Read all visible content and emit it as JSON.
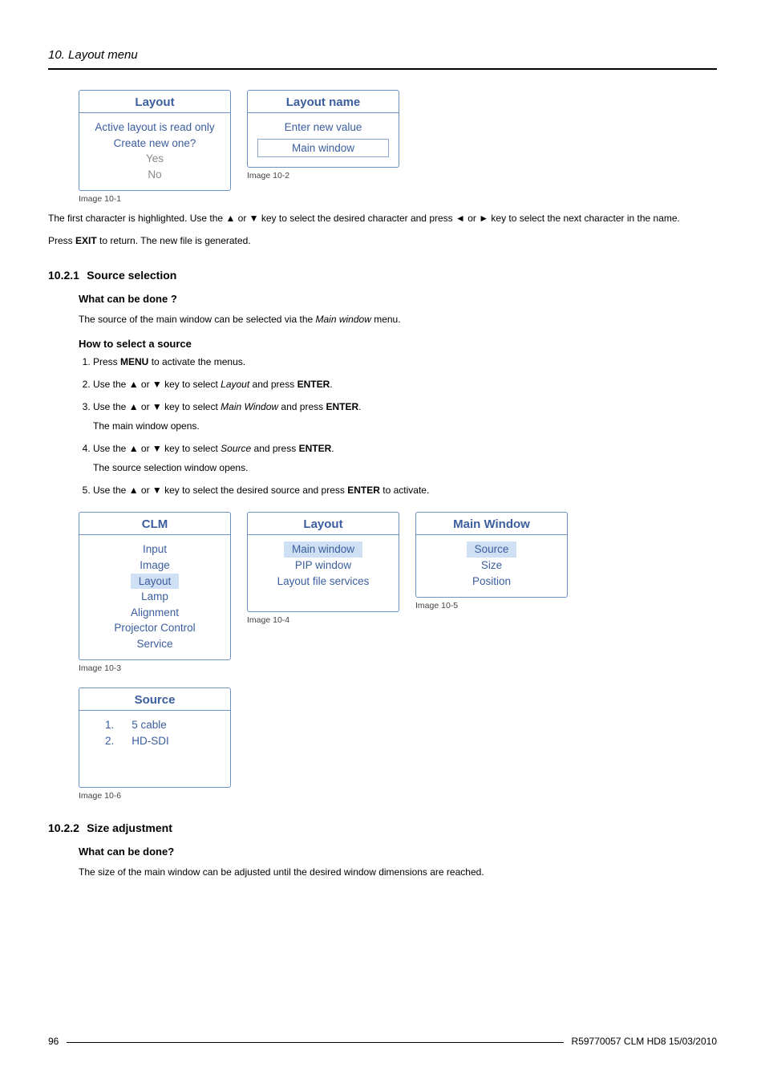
{
  "header": {
    "title": "10. Layout menu"
  },
  "osd": {
    "img1": {
      "title": "Layout",
      "line1": "Active layout is read only",
      "line2": "Create new one?",
      "line3": "Yes",
      "line4": "No",
      "caption": "Image 10-1"
    },
    "img2": {
      "title": "Layout name",
      "line1": "Enter new value",
      "input": "Main window",
      "caption": "Image 10-2"
    },
    "img3": {
      "title": "CLM",
      "items": [
        "Input",
        "Image",
        "Layout",
        "Lamp",
        "Alignment",
        "Projector Control",
        "Service"
      ],
      "caption": "Image 10-3"
    },
    "img4": {
      "title": "Layout",
      "items": [
        "Main window",
        "PIP window",
        "Layout file services"
      ],
      "caption": "Image 10-4"
    },
    "img5": {
      "title": "Main Window",
      "items": [
        "Source",
        "Size",
        "Position"
      ],
      "caption": "Image 10-5"
    },
    "img6": {
      "title": "Source",
      "rows": [
        {
          "n": "1.",
          "v": "5 cable"
        },
        {
          "n": "2.",
          "v": "HD-SDI"
        }
      ],
      "caption": "Image 10-6"
    }
  },
  "text": {
    "p1a": "The first character is highlighted.  Use the ▲ or ▼ key to select the desired character and press ◄ or ► key to select the next character in the name.",
    "p1b_pre": "Press ",
    "p1b_bold": "EXIT",
    "p1b_post": " to return.  The new file is generated."
  },
  "sec_10_2_1": {
    "num": "10.2.1",
    "title": "Source selection",
    "q": "What can be done ?",
    "a_pre": "The source of the main window can be selected via the ",
    "a_it": "Main window",
    "a_post": " menu.",
    "how": "How to select a source",
    "steps": {
      "s1_pre": "Press ",
      "s1_b": "MENU",
      "s1_post": " to activate the menus.",
      "s2_pre": "Use the ▲ or ▼ key to select ",
      "s2_it": "Layout",
      "s2_mid": " and press ",
      "s2_b": "ENTER",
      "s2_post": ".",
      "s3_pre": "Use the ▲ or ▼ key to select ",
      "s3_it": "Main Window",
      "s3_mid": " and press ",
      "s3_b": "ENTER",
      "s3_post": ".",
      "s3_sub": "The main window opens.",
      "s4_pre": "Use the ▲ or ▼ key to select ",
      "s4_it": "Source",
      "s4_mid": " and press ",
      "s4_b": "ENTER",
      "s4_post": ".",
      "s4_sub": "The source selection window opens.",
      "s5_pre": "Use the ▲ or ▼ key to select the desired source and press ",
      "s5_b": "ENTER",
      "s5_post": " to activate."
    }
  },
  "sec_10_2_2": {
    "num": "10.2.2",
    "title": "Size adjustment",
    "q": "What can be done?",
    "a": "The size of the main window can be adjusted until the desired window dimensions are reached."
  },
  "footer": {
    "page": "96",
    "right": "R59770057  CLM HD8  15/03/2010"
  }
}
